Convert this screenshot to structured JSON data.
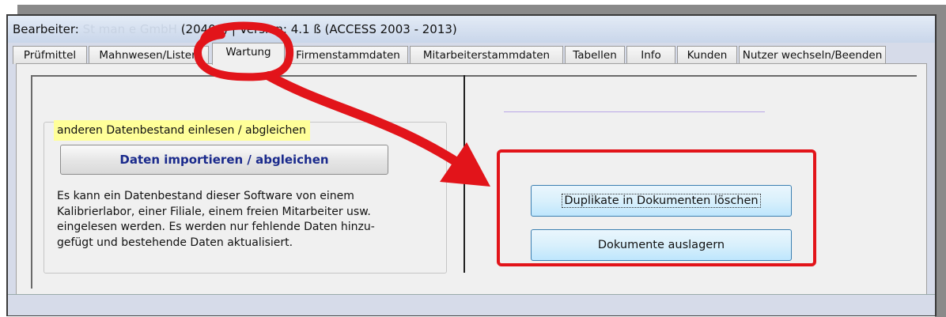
{
  "window": {
    "title_prefix": "Bearbeiter: ",
    "title_user_blurred": "St          man                           e GmbH",
    "title_suffix": " (20400)  | Version: 4.1 ß (ACCESS 2003 - 2013)"
  },
  "tabs": [
    {
      "label": "Prüfmittel"
    },
    {
      "label": "Mahnwesen/Listen"
    },
    {
      "label": "Wartung",
      "active": true
    },
    {
      "label": "Firmenstammdaten"
    },
    {
      "label": "Mitarbeiterstammdaten"
    },
    {
      "label": "Tabellen"
    },
    {
      "label": "Info"
    },
    {
      "label": "Kunden"
    },
    {
      "label": "Nutzer wechseln/Beenden"
    }
  ],
  "import_section": {
    "header": "anderen Datenbestand einlesen / abgleichen",
    "button_label": "Daten importieren / abgleichen",
    "description": "Es kann ein Datenbestand dieser Software von einem\nKalibrierlabor, einer Filiale, einem freien Mitarbeiter usw.\neingelesen werden. Es werden nur fehlende Daten hinzu-\ngefügt und bestehende Daten aktualisiert."
  },
  "maintenance_buttons": {
    "duplicates_label": "Duplikate in Dokumenten löschen",
    "archive_label": "Dokumente auslagern"
  },
  "annotation": {
    "color": "#e2141a"
  }
}
